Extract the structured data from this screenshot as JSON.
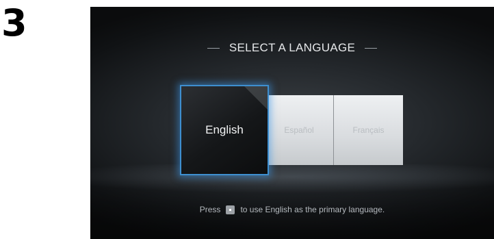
{
  "step": {
    "number": "3"
  },
  "screen": {
    "title": "SELECT A LANGUAGE",
    "languages": [
      {
        "label": "English",
        "selected": true
      },
      {
        "label": "Español",
        "selected": false
      },
      {
        "label": "Français",
        "selected": false
      }
    ],
    "instruction": {
      "before_key": "Press",
      "key_icon": "ok-button-icon",
      "after_key": "to use English as the primary language."
    }
  },
  "colors": {
    "selection_border": "#3e8fd0",
    "screen_background": "#24282c",
    "unselected_tile": "#d9dcdf"
  }
}
